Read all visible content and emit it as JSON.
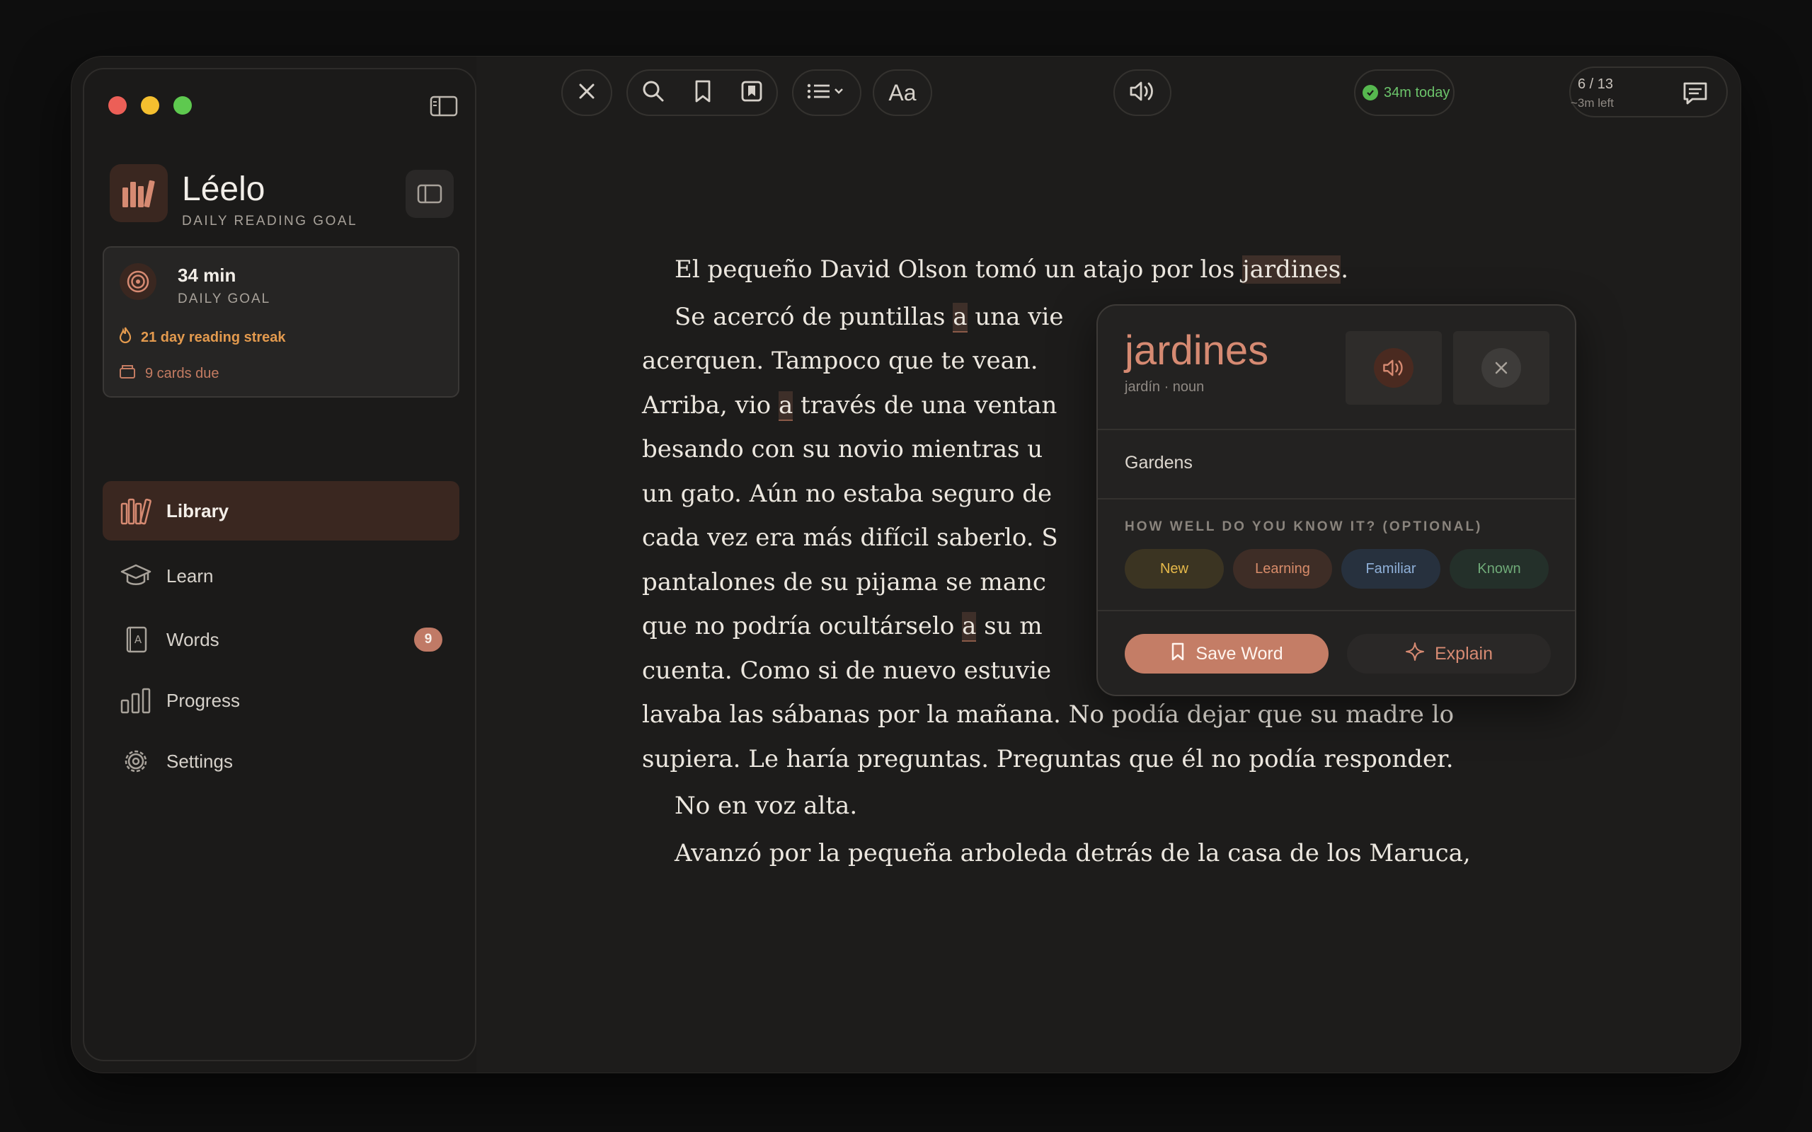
{
  "app": {
    "name": "Léelo",
    "subtitle": "DAILY READING GOAL"
  },
  "goal": {
    "value": "34 min",
    "label": "DAILY GOAL",
    "streak": "21 day reading streak",
    "cards_due": "9 cards due"
  },
  "nav": [
    {
      "label": "Library",
      "icon": "library-icon",
      "active": true
    },
    {
      "label": "Learn",
      "icon": "graduation-cap-icon"
    },
    {
      "label": "Words",
      "icon": "word-book-icon",
      "badge": "9"
    },
    {
      "label": "Progress",
      "icon": "bar-chart-icon"
    },
    {
      "label": "Settings",
      "icon": "gear-icon"
    }
  ],
  "toolbar": {
    "time_today": "34m today",
    "page_count": "6 / 13",
    "time_left": "~3m left",
    "font_button": "Aa"
  },
  "reader": {
    "p1_before": "El pequeño David Olson tomó un atajo por los ",
    "p1_word": "jardines",
    "p1_after": ".",
    "p2_l1_a": "Se acercó de puntillas ",
    "p2_l1_b": "a",
    "p2_l1_c": " una vie",
    "p2_l2": "acerquen. Tampoco que te vean. ",
    "p2_l3_a": "Arriba, vio ",
    "p2_l3_b": "a",
    "p2_l3_c": " través de una ventan",
    "p2_l4": "besando con su novio mientras u",
    "p2_l5": "un gato. Aún no estaba seguro de",
    "p2_l6": "cada vez era más difícil saberlo. S",
    "p2_l7": "pantalones de su pijama se manc",
    "p2_l8_a": "que no podría ocultárselo ",
    "p2_l8_b": "a",
    "p2_l8_c": " su m",
    "p2_l9": "cuenta. Como si de nuevo estuvie",
    "p2_l10": "lavaba las sábanas por la mañana. No podía dejar que su madre lo",
    "p2_l11": "supiera. Le haría preguntas. Preguntas que él no podía responder.",
    "p3": "No en voz alta.",
    "p4": "Avanzó por la pequeña arboleda detrás de la casa de los Maruca,"
  },
  "popup": {
    "word": "jardines",
    "meta": "jardín · noun",
    "translation": "Gardens",
    "question": "HOW WELL DO YOU KNOW IT? (OPTIONAL)",
    "levels": [
      "New",
      "Learning",
      "Familiar",
      "Known"
    ],
    "save_label": "Save Word",
    "explain_label": "Explain"
  },
  "colors": {
    "accent": "#c47d66",
    "background": "#1b1a19",
    "streak": "#e39a4e",
    "success": "#56b84f"
  }
}
